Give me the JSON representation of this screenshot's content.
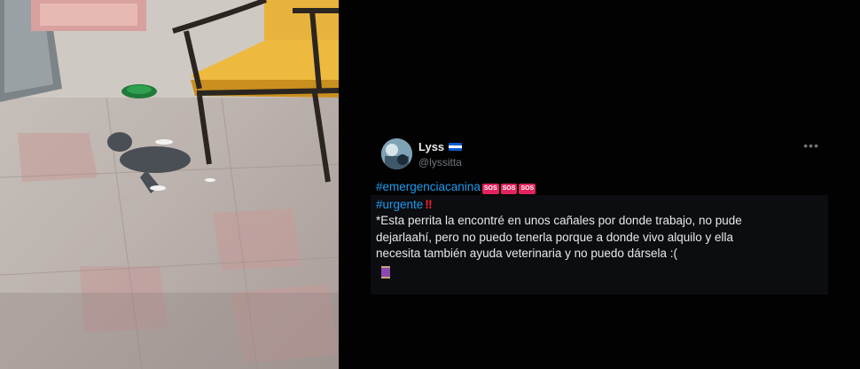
{
  "tweet": {
    "display_name": "Lyss",
    "handle": "@lyssitta",
    "more_label": "•••",
    "hashtag1": "#emergenciacanina",
    "sos_label": "SOS",
    "hashtag2": "#urgente",
    "bang": "‼",
    "text_line1": "*Esta perrita la encontré en unos  cañales por donde trabajo,  no pude",
    "text_line2": "dejarlaahí, pero no puedo tenerla porque a donde vivo alquilo y ella",
    "text_line3": "necesita también ayuda veterinaria y no puedo dársela :(",
    "flag_colors": [
      "#0b59c8",
      "#ffffff",
      "#0b59c8"
    ]
  },
  "icons": {
    "spool": "thread-spool-icon",
    "more": "more-icon"
  }
}
